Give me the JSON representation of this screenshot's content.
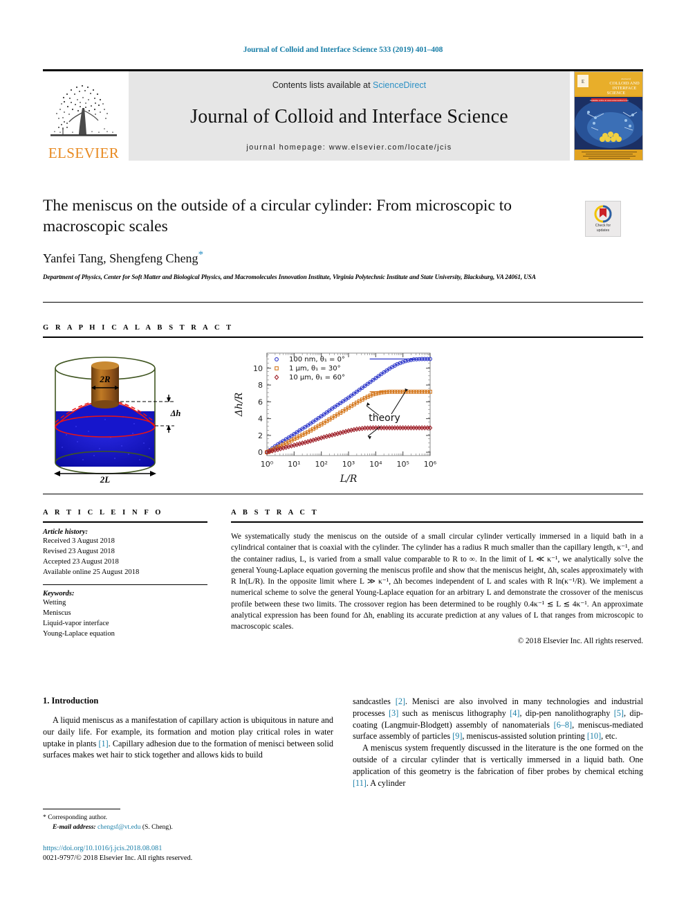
{
  "running_head": "Journal of Colloid and Interface Science 533 (2019) 401–408",
  "masthead": {
    "contents_prefix": "Contents lists available at ",
    "sciencedirect": "ScienceDirect",
    "journal_title": "Journal of Colloid and Interface Science",
    "homepage": "journal homepage: www.elsevier.com/locate/jcis",
    "publisher": "ELSEVIER",
    "cover_line1": "Journal of",
    "cover_line2": "COLLOID AND",
    "cover_line3": "INTERFACE",
    "cover_line4": "SCIENCE"
  },
  "article": {
    "title": "The meniscus on the outside of a circular cylinder: From microscopic to macroscopic scales",
    "authors": "Yanfei Tang, Shengfeng Cheng",
    "corresponding_marker": "*",
    "affiliation": "Department of Physics, Center for Soft Matter and Biological Physics, and Macromolecules Innovation Institute, Virginia Polytechnic Institute and State University, Blacksburg, VA 24061, USA",
    "crossmark_line1": "Check for",
    "crossmark_line2": "updates"
  },
  "sections": {
    "graphical_abstract": "G R A P H I C A L   A B S T R A C T",
    "article_info": "A R T I C L E   I N F O",
    "abstract": "A B S T R A C T"
  },
  "article_info": {
    "history_label": "Article history:",
    "history": [
      "Received 3 August 2018",
      "Revised 23 August 2018",
      "Accepted 23 August 2018",
      "Available online 25 August 2018"
    ],
    "keywords_label": "Keywords:",
    "keywords": [
      "Wetting",
      "Meniscus",
      "Liquid-vapor interface",
      "Young-Laplace equation"
    ]
  },
  "abstract": {
    "text": "We systematically study the meniscus on the outside of a small circular cylinder vertically immersed in a liquid bath in a cylindrical container that is coaxial with the cylinder. The cylinder has a radius R much smaller than the capillary length, κ⁻¹, and the container radius, L, is varied from a small value comparable to R to ∞. In the limit of L ≪ κ⁻¹, we analytically solve the general Young-Laplace equation governing the meniscus profile and show that the meniscus height, Δh, scales approximately with R ln(L/R). In the opposite limit where L ≫ κ⁻¹, Δh becomes independent of L and scales with R ln(κ⁻¹/R). We implement a numerical scheme to solve the general Young-Laplace equation for an arbitrary L and demonstrate the crossover of the meniscus profile between these two limits. The crossover region has been determined to be roughly 0.4κ⁻¹ ≲ L ≲ 4κ⁻¹. An approximate analytical expression has been found for Δh, enabling its accurate prediction at any values of L that ranges from microscopic to macroscopic scales.",
    "copyright": "© 2018 Elsevier Inc. All rights reserved."
  },
  "body": {
    "intro_heading": "1. Introduction",
    "left_paragraph_1": "A liquid meniscus as a manifestation of capillary action is ubiquitous in nature and our daily life. For example, its formation and motion play critical roles in water uptake in plants [1]. Capillary adhesion due to the formation of menisci between solid surfaces makes wet hair to stick together and allows kids to build",
    "right_paragraph_1": "sandcastles [2]. Menisci are also involved in many technologies and industrial processes [3] such as meniscus lithography [4], dip-pen nanolithography [5], dip-coating (Langmuir-Blodgett) assembly of nanomaterials [6–8], meniscus-mediated surface assembly of particles [9], meniscus-assisted solution printing [10], etc.",
    "right_paragraph_2": "A meniscus system frequently discussed in the literature is the one formed on the outside of a circular cylinder that is vertically immersed in a liquid bath. One application of this geometry is the fabrication of fiber probes by chemical etching [11]. A cylinder"
  },
  "footer": {
    "corr_marker": "*",
    "corr_label": "Corresponding author.",
    "email_label": "E-mail address:",
    "email": "chengsf@vt.edu",
    "email_suffix": "(S. Cheng).",
    "doi": "https://doi.org/10.1016/j.jcis.2018.08.081",
    "issn": "0021-9797/© 2018 Elsevier Inc. All rights reserved."
  },
  "figure_left": {
    "label_2R": "2R",
    "label_dh": "Δh",
    "label_2L": "2L"
  },
  "chart_data": {
    "type": "line",
    "title": "",
    "xlabel": "L/R",
    "ylabel": "Δh/R",
    "xscale": "log",
    "xlim": [
      1,
      1000000
    ],
    "ylim": [
      -0.4,
      11.8
    ],
    "xticks": [
      "10⁰",
      "10¹",
      "10²",
      "10³",
      "10⁴",
      "10⁵",
      "10⁶"
    ],
    "yticks": [
      0,
      2,
      4,
      6,
      8,
      10
    ],
    "grid": false,
    "legend_position": "upper-left",
    "annotation": "theory",
    "series": [
      {
        "name": "100 nm, θ₁ = 0°",
        "color": "#2b35c9",
        "marker": "circle",
        "plateau": 11.1,
        "x": [
          1,
          2,
          4,
          8,
          16,
          32,
          63,
          125,
          250,
          500,
          1000,
          2000,
          4000,
          8000,
          16000,
          32000,
          63000,
          125000,
          250000,
          500000,
          1000000
        ],
        "y": [
          0.0,
          0.72,
          1.35,
          1.95,
          2.6,
          3.2,
          3.85,
          4.5,
          5.2,
          5.85,
          6.5,
          7.2,
          7.9,
          8.6,
          9.3,
          9.95,
          10.5,
          10.85,
          11.05,
          11.1,
          11.1
        ]
      },
      {
        "name": "1 μm, θ₁ = 30°",
        "color": "#d4761b",
        "marker": "square",
        "plateau": 7.2,
        "x": [
          1,
          2,
          4,
          8,
          16,
          32,
          63,
          125,
          250,
          500,
          1000,
          2000,
          4000,
          8000,
          16000,
          32000,
          63000,
          125000,
          250000,
          500000,
          1000000
        ],
        "y": [
          0.0,
          0.45,
          0.9,
          1.4,
          1.9,
          2.4,
          2.95,
          3.5,
          4.1,
          4.7,
          5.3,
          5.9,
          6.45,
          6.9,
          7.12,
          7.2,
          7.2,
          7.2,
          7.2,
          7.2,
          7.2
        ]
      },
      {
        "name": "10 μm, θ₁ = 60°",
        "color": "#9e1f28",
        "marker": "diamond",
        "plateau": 2.9,
        "x": [
          1,
          2,
          4,
          8,
          16,
          32,
          63,
          125,
          250,
          500,
          1000,
          2000,
          4000,
          8000,
          16000,
          32000,
          63000,
          125000,
          250000,
          500000,
          1000000
        ],
        "y": [
          0.0,
          0.25,
          0.5,
          0.75,
          1.0,
          1.25,
          1.52,
          1.8,
          2.05,
          2.3,
          2.55,
          2.75,
          2.87,
          2.9,
          2.9,
          2.9,
          2.9,
          2.9,
          2.9,
          2.9,
          2.9
        ]
      }
    ]
  }
}
